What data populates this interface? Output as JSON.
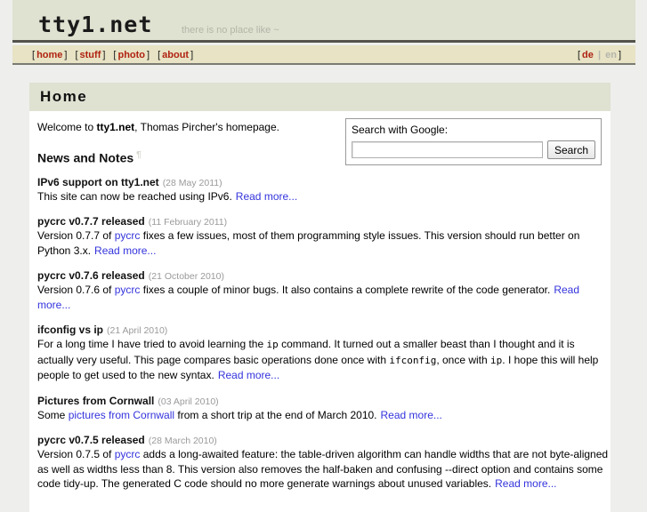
{
  "header": {
    "site_title": "tty1.net",
    "tagline": "there is no place like ~"
  },
  "nav": {
    "items": [
      {
        "label": "home",
        "active": true
      },
      {
        "label": "stuff",
        "active": false
      },
      {
        "label": "photo",
        "active": false
      },
      {
        "label": "about",
        "active": false
      }
    ],
    "languages": {
      "de": "de",
      "separator": "|",
      "en": "en"
    },
    "bracket_open": "[",
    "bracket_close": "]"
  },
  "page": {
    "heading": "Home",
    "intro_prefix": "Welcome to ",
    "intro_brand": "tty1.net",
    "intro_suffix": ", Thomas Pircher's homepage.",
    "news_heading": "News and Notes",
    "news_feed_mark": "¶"
  },
  "search": {
    "label": "Search with Google:",
    "value": "",
    "placeholder": "",
    "button_label": "Search"
  },
  "news": [
    {
      "title": "IPv6 support on tty1.net",
      "date": "(28 May 2011)",
      "body_parts": [
        {
          "type": "text",
          "text": "This site can now be reached using IPv6."
        }
      ],
      "read_more": "Read more..."
    },
    {
      "title": "pycrc v0.7.7 released",
      "date": "(11 February 2011)",
      "body_parts": [
        {
          "type": "text",
          "text": "Version 0.7.7 of "
        },
        {
          "type": "link",
          "text": "pycrc"
        },
        {
          "type": "text",
          "text": " fixes a few issues, most of them programming style issues. This version should run better on Python 3.x."
        }
      ],
      "read_more": "Read more..."
    },
    {
      "title": "pycrc v0.7.6 released",
      "date": "(21 October 2010)",
      "body_parts": [
        {
          "type": "text",
          "text": "Version 0.7.6 of "
        },
        {
          "type": "link",
          "text": "pycrc"
        },
        {
          "type": "text",
          "text": " fixes a couple of minor bugs. It also contains a complete rewrite of the code generator."
        }
      ],
      "read_more": "Read more..."
    },
    {
      "title": "ifconfig vs ip",
      "date": "(21 April 2010)",
      "body_parts": [
        {
          "type": "text",
          "text": "For a long time I have tried to avoid learning the "
        },
        {
          "type": "code",
          "text": "ip"
        },
        {
          "type": "text",
          "text": " command. It turned out a smaller beast than I thought and it is actually very useful. This page compares basic operations done once with "
        },
        {
          "type": "code",
          "text": "ifconfig"
        },
        {
          "type": "text",
          "text": ", once with "
        },
        {
          "type": "code",
          "text": "ip"
        },
        {
          "type": "text",
          "text": ". I hope this will help people to get used to the new syntax."
        }
      ],
      "read_more": "Read more..."
    },
    {
      "title": "Pictures from Cornwall",
      "date": "(03 April 2010)",
      "body_parts": [
        {
          "type": "text",
          "text": "Some "
        },
        {
          "type": "link",
          "text": "pictures from Cornwall"
        },
        {
          "type": "text",
          "text": " from a short trip at the end of March 2010."
        }
      ],
      "read_more": "Read more..."
    },
    {
      "title": "pycrc v0.7.5 released",
      "date": "(28 March 2010)",
      "body_parts": [
        {
          "type": "text",
          "text": "Version 0.7.5 of "
        },
        {
          "type": "link",
          "text": "pycrc"
        },
        {
          "type": "text",
          "text": " adds a long-awaited feature: the table-driven algorithm can handle widths that are not byte-aligned as well as widths less than 8. This version also removes the half-baken and confusing --direct option and contains some code tidy-up. The generated C code should no more generate warnings about unused variables."
        }
      ],
      "read_more": "Read more..."
    }
  ],
  "colors": {
    "header_band": "#dfe1d1",
    "nav_band": "#e7e3c4",
    "nav_link": "#b02211",
    "link": "#3333dd",
    "page_background": "#eeeeec",
    "content_background": "#ffffff"
  }
}
